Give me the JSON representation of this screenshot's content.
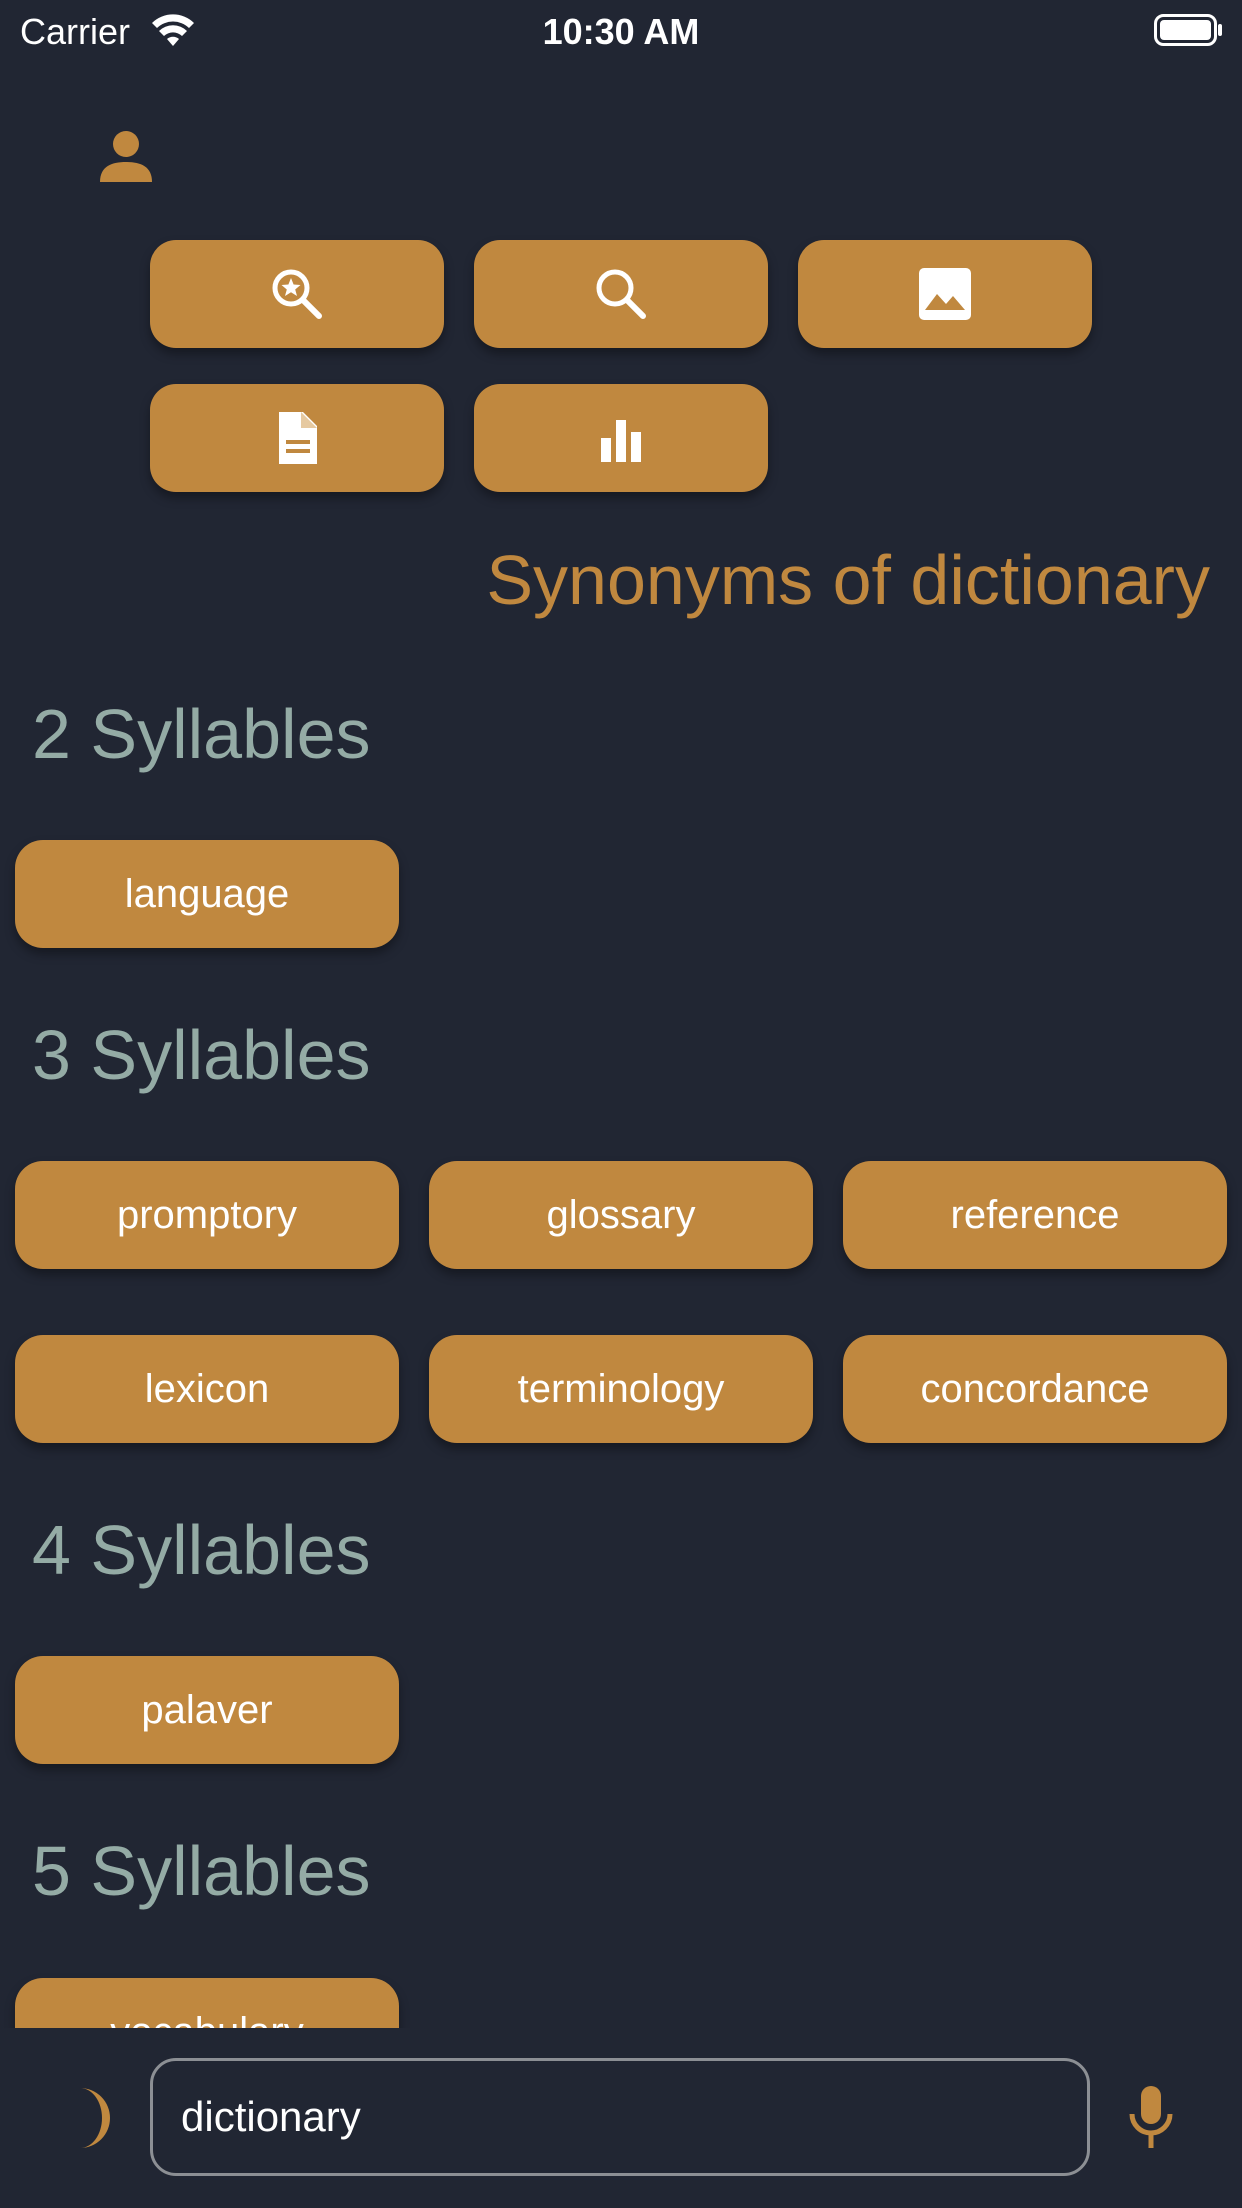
{
  "status_bar": {
    "carrier": "Carrier",
    "time": "10:30 AM"
  },
  "toolbar": {
    "buttons": [
      {
        "name": "rhymes-search",
        "icon": "search-star-icon"
      },
      {
        "name": "search",
        "icon": "search-icon"
      },
      {
        "name": "images",
        "icon": "image-icon"
      },
      {
        "name": "definition",
        "icon": "document-icon"
      },
      {
        "name": "statistics",
        "icon": "bar-chart-icon"
      }
    ]
  },
  "page": {
    "heading": "Synonyms of dictionary"
  },
  "sections": [
    {
      "title": "2 Syllables",
      "words": [
        "language"
      ]
    },
    {
      "title": "3 Syllables",
      "words": [
        "promptory",
        "glossary",
        "reference",
        "lexicon",
        "terminology",
        "concordance"
      ]
    },
    {
      "title": "4 Syllables",
      "words": [
        "palaver"
      ]
    },
    {
      "title": "5 Syllables",
      "words": [
        "vocabulary"
      ]
    }
  ],
  "search": {
    "value": "dictionary"
  },
  "colors": {
    "background": "#212633",
    "accent": "#c0883f",
    "section_title": "#94aba5",
    "text_on_accent": "#ffffff"
  }
}
